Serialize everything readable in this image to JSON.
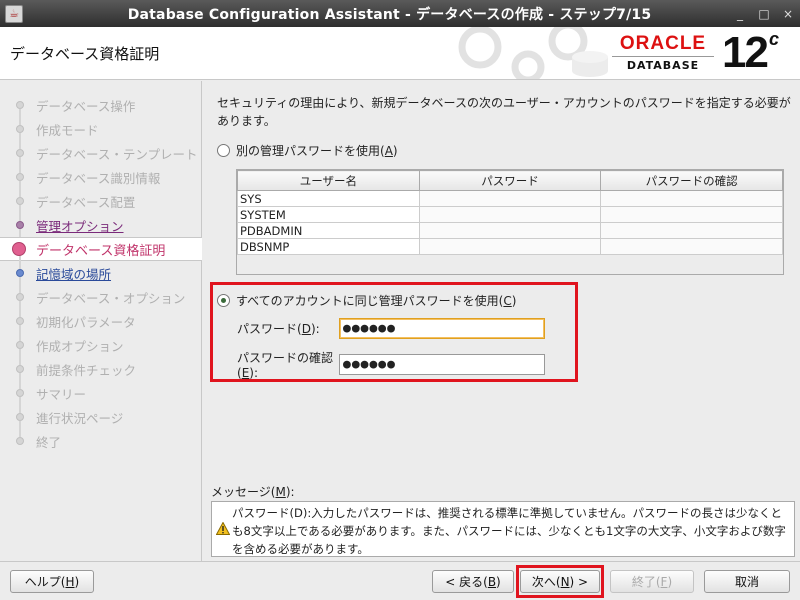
{
  "window": {
    "title": "Database Configuration Assistant - データベースの作成 - ステップ7/15",
    "minimize": "_",
    "maximize": "□",
    "close": "×"
  },
  "header": {
    "page_title": "データベース資格証明",
    "logo_text": "ORACLE",
    "logo_sub": "DATABASE",
    "version": "12",
    "version_sup": "c"
  },
  "sidebar": {
    "steps": [
      {
        "label": "データベース操作",
        "state": "disabled"
      },
      {
        "label": "作成モード",
        "state": "disabled"
      },
      {
        "label": "データベース・テンプレート",
        "state": "disabled"
      },
      {
        "label": "データベース識別情報",
        "state": "disabled"
      },
      {
        "label": "データベース配置",
        "state": "disabled"
      },
      {
        "label": "管理オプション",
        "state": "done"
      },
      {
        "label": "データベース資格証明",
        "state": "current"
      },
      {
        "label": "記憶域の場所",
        "state": "next"
      },
      {
        "label": "データベース・オプション",
        "state": "disabled"
      },
      {
        "label": "初期化パラメータ",
        "state": "disabled"
      },
      {
        "label": "作成オプション",
        "state": "disabled"
      },
      {
        "label": "前提条件チェック",
        "state": "disabled"
      },
      {
        "label": "サマリー",
        "state": "disabled"
      },
      {
        "label": "進行状況ページ",
        "state": "disabled"
      },
      {
        "label": "終了",
        "state": "disabled"
      }
    ]
  },
  "main": {
    "intro": "セキュリティの理由により、新規データベースの次のユーザー・アカウントのパスワードを指定する必要があります。",
    "option_separate": {
      "text": "別の管理パスワードを使用(",
      "key": "A",
      "end": ")",
      "selected": false
    },
    "table": {
      "headers": [
        "ユーザー名",
        "パスワード",
        "パスワードの確認"
      ],
      "rows": [
        "SYS",
        "SYSTEM",
        "PDBADMIN",
        "DBSNMP"
      ]
    },
    "option_same": {
      "text": "すべてのアカウントに同じ管理パスワードを使用(",
      "key": "C",
      "end": ")",
      "selected": true
    },
    "password": {
      "label": "パスワード(",
      "key": "D",
      "end": "):",
      "value": "●●●●●●"
    },
    "confirm": {
      "label": "パスワードの確認(",
      "key": "E",
      "end": "):",
      "value": "●●●●●●"
    },
    "message_label": {
      "text": "メッセージ(",
      "key": "M",
      "end": "):"
    },
    "message": "パスワード(D):入力したパスワードは、推奨される標準に準拠していません。パスワードの長さは少なくとも8文字以上である必要があります。また、パスワードには、少なくとも1文字の大文字、小文字および数字を含める必要があります。"
  },
  "footer": {
    "help": {
      "text": "ヘルプ(",
      "key": "H",
      "end": ")"
    },
    "back": {
      "text": "< 戻る(",
      "key": "B",
      "end": ")"
    },
    "next": {
      "text": "次へ(",
      "key": "N",
      "end": ") >"
    },
    "finish": {
      "text": "終了(",
      "key": "F",
      "end": ")"
    },
    "cancel": {
      "text": "取消"
    }
  },
  "colors": {
    "accent": "#c0336a",
    "highlight": "#e0141e",
    "oracle_red": "#d11111"
  }
}
